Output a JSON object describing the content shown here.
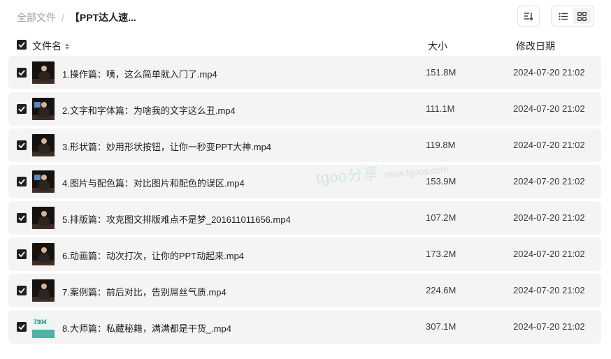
{
  "breadcrumb": {
    "root": "全部文件",
    "separator": "/",
    "current": "【PPT达人速..."
  },
  "toolbar": {
    "sort_icon": "sort-icon",
    "list_view_icon": "list-view-icon",
    "grid_view_icon": "grid-view-icon"
  },
  "columns": {
    "name": "文件名",
    "size": "大小",
    "date": "修改日期"
  },
  "files": [
    {
      "name": "1.操作篇：咦，这么简单就入门了.mp4",
      "size": "151.8M",
      "date": "2024-07-20 21:02",
      "thumb": "presenter"
    },
    {
      "name": "2.文字和字体篇：为啥我的文字这么丑.mp4",
      "size": "111.1M",
      "date": "2024-07-20 21:02",
      "thumb": "presenter-screen"
    },
    {
      "name": "3.形状篇：妙用形状按钮，让你一秒变PPT大神.mp4",
      "size": "119.8M",
      "date": "2024-07-20 21:02",
      "thumb": "presenter"
    },
    {
      "name": "4.图片与配色篇：对比图片和配色的误区.mp4",
      "size": "153.9M",
      "date": "2024-07-20 21:02",
      "thumb": "presenter-screen"
    },
    {
      "name": "5.排版篇：攻克图文排版难点不是梦_201611011656.mp4",
      "size": "107.2M",
      "date": "2024-07-20 21:02",
      "thumb": "presenter"
    },
    {
      "name": "6.动画篇：动次打次，让你的PPT动起来.mp4",
      "size": "173.2M",
      "date": "2024-07-20 21:02",
      "thumb": "presenter"
    },
    {
      "name": "7.案例篇：前后对比，告别屌丝气质.mp4",
      "size": "224.6M",
      "date": "2024-07-20 21:02",
      "thumb": "presenter"
    },
    {
      "name": "8.大师篇：私藏秘籍，满满都是干货_.mp4",
      "size": "307.1M",
      "date": "2024-07-20 21:02",
      "thumb": "infographic",
      "thumb_text": "7304"
    }
  ],
  "watermark": {
    "brand": "tgoo分享",
    "url": "www.tgoos.com"
  },
  "colors": {
    "row_bg": "#f4f4f5",
    "checkbox": "#1f1f1f",
    "watermark_brand": "#b7dccd"
  }
}
